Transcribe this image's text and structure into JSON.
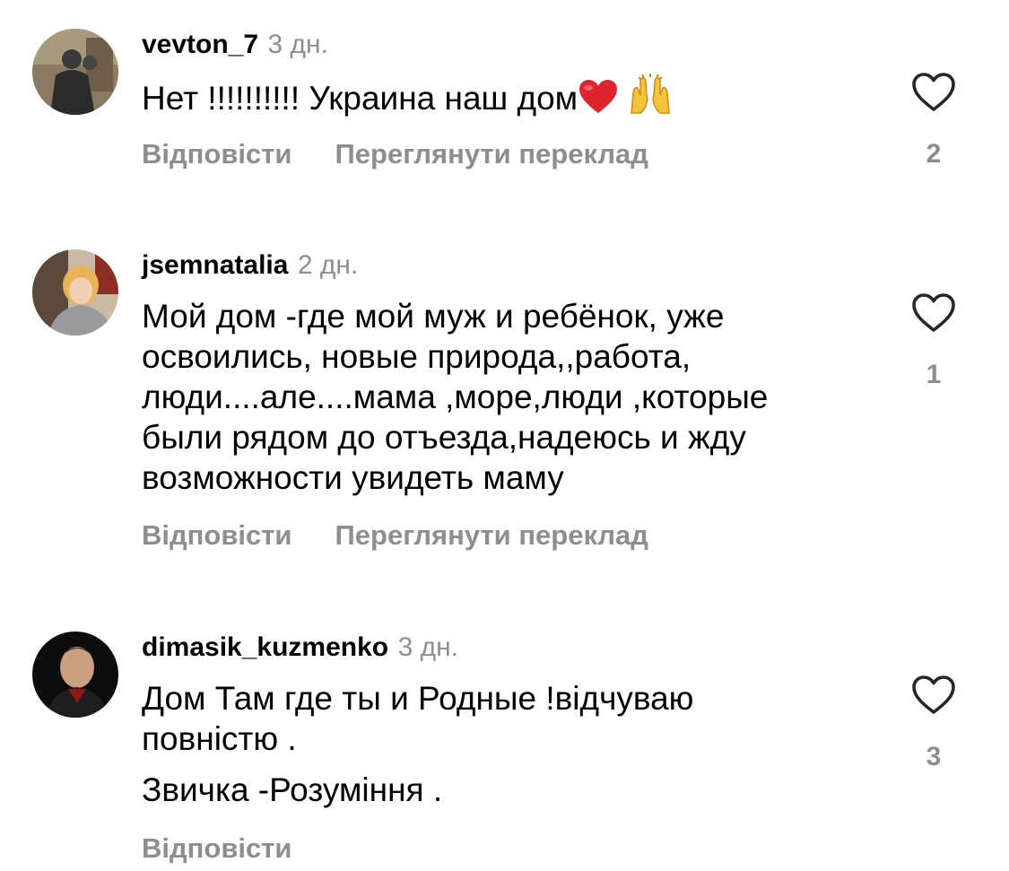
{
  "comments": [
    {
      "username": "vevton_7",
      "time": "3 дн.",
      "text_lines": [
        "Нет !!!!!!!!!! Украина наш дом"
      ],
      "emoji": [
        "red-heart-emoji",
        "raising-hands-emoji"
      ],
      "reply_label": "Відповісти",
      "translate_label": "Переглянути переклад",
      "likes": "2"
    },
    {
      "username": "jsemnatalia",
      "time": "2 дн.",
      "text_lines": [
        "Мой дом -где мой муж и ребёнок, уже освоились, новые природа,,работа, люди....але....мама ,море,люди ,которые были рядом до отъезда,надеюсь и жду возможности увидеть маму"
      ],
      "reply_label": "Відповісти",
      "translate_label": "Переглянути переклад",
      "likes": "1"
    },
    {
      "username": "dimasik_kuzmenko",
      "time": "3 дн.",
      "text_lines": [
        "Дом Там где ты и Родные !відчуваю повністю .",
        "Звичка -Розуміння ."
      ],
      "reply_label": "Відповісти",
      "likes": "3"
    }
  ],
  "colors": {
    "secondary_text": "#8e8e8e",
    "primary_text": "#000000",
    "background": "#ffffff"
  },
  "icons": {
    "like": "heart-outline-icon"
  }
}
